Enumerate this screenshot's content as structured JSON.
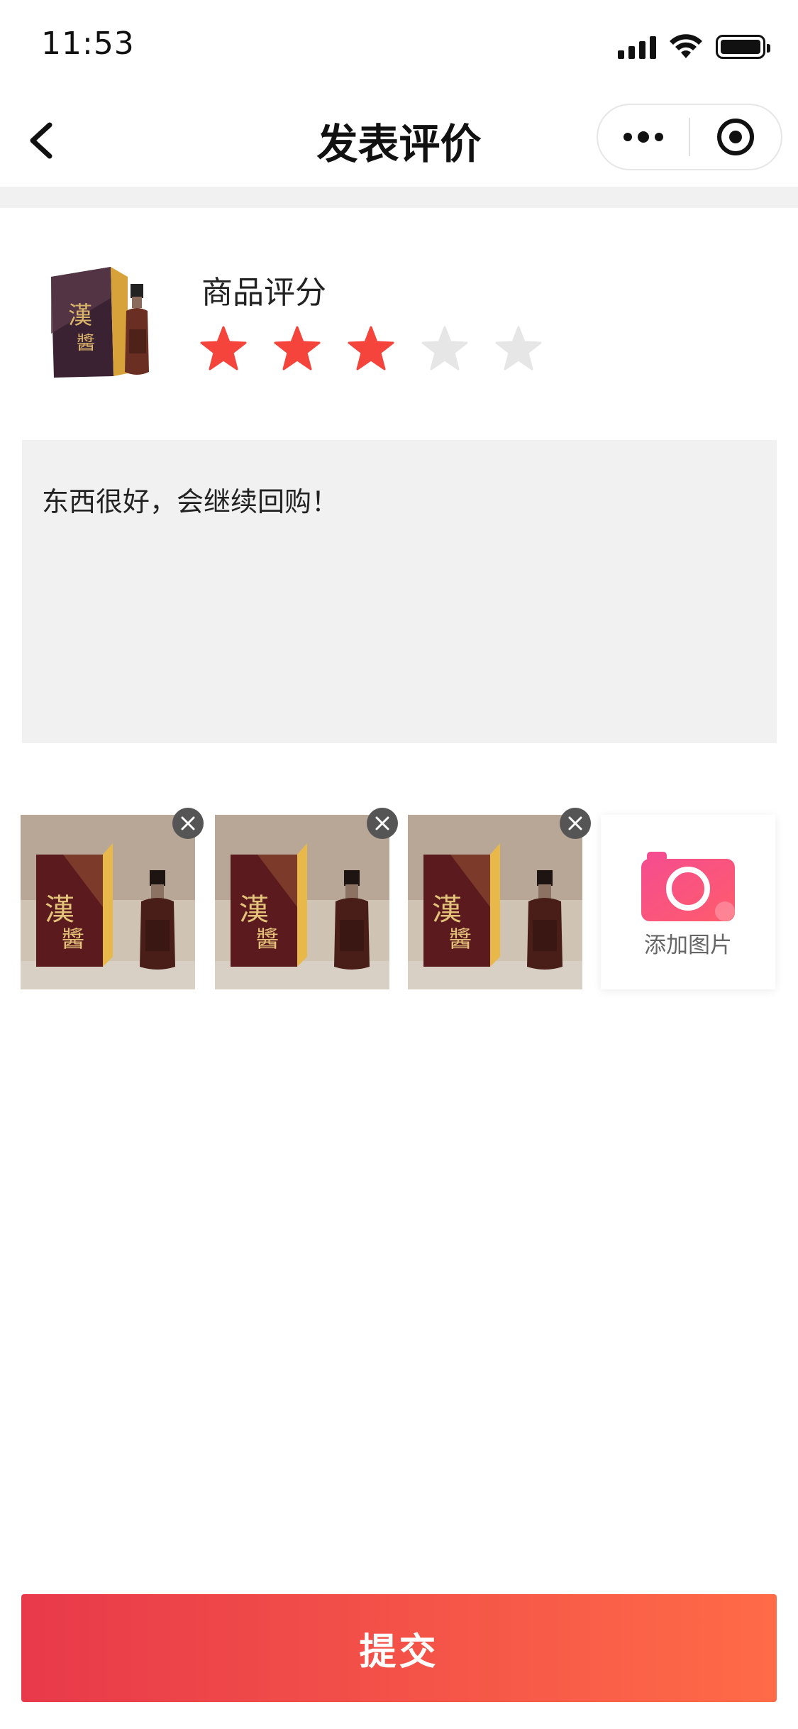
{
  "status_bar": {
    "time": "11:53"
  },
  "nav": {
    "title": "发表评价"
  },
  "product": {
    "rating_label": "商品评分",
    "rating": 3,
    "max_rating": 5,
    "star_active_color": "#f5443b",
    "star_inactive_color": "#e6e6e6",
    "image_icon": "liquor-bottle-box-image"
  },
  "review": {
    "text": "东西很好，会继续回购！"
  },
  "photos": {
    "items": [
      {
        "icon": "liquor-photo"
      },
      {
        "icon": "liquor-photo"
      },
      {
        "icon": "liquor-photo"
      }
    ],
    "add_label": "添加图片",
    "add_icon": "camera-icon"
  },
  "submit": {
    "label": "提交",
    "gradient_start": "#e8394a",
    "gradient_end": "#ff6b47"
  }
}
